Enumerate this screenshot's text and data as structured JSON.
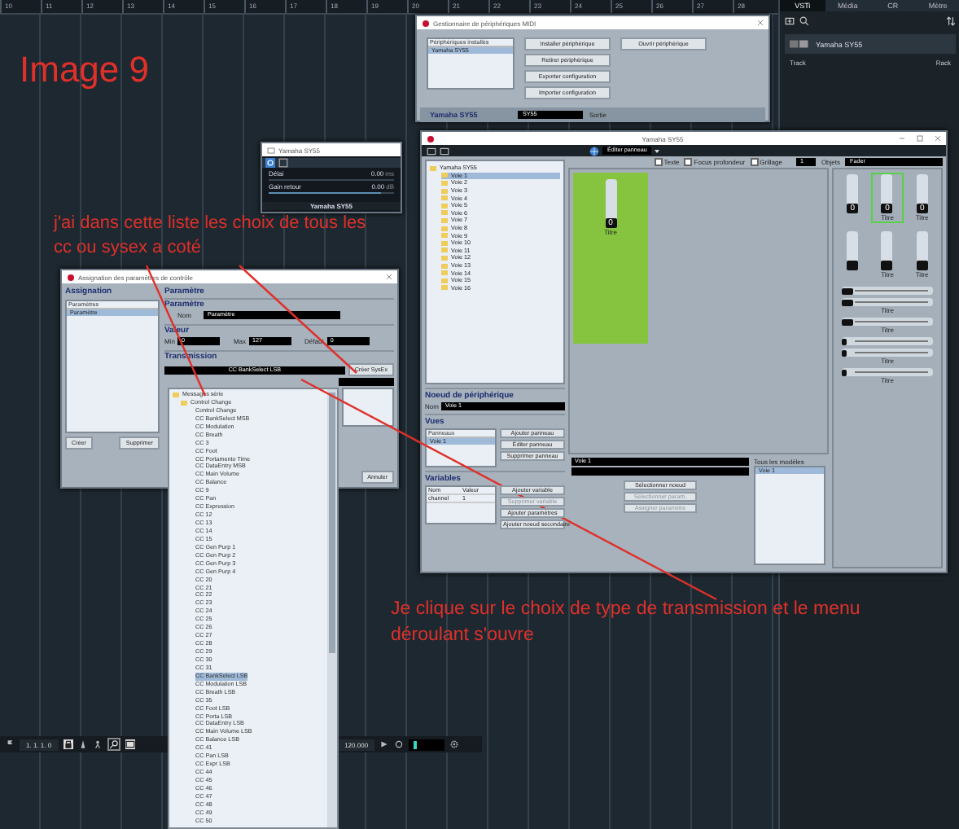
{
  "ruler": [
    "10",
    "11",
    "12",
    "13",
    "14",
    "15",
    "16",
    "17",
    "18",
    "19",
    "20",
    "21",
    "22",
    "23",
    "24",
    "25",
    "26",
    "27",
    "28"
  ],
  "title_note": "Image 9",
  "notes": [
    "j'ai dans cette liste les choix de tous les cc ou sysex a coté",
    "Je clique sur le choix de type de transmission et le menu déroulant s'ouvre"
  ],
  "right_panel": {
    "tabs": [
      {
        "label": "VSTi",
        "selected": true
      },
      {
        "label": "Média",
        "selected": false
      },
      {
        "label": "CR",
        "selected": false
      },
      {
        "label": "Mètre",
        "selected": false
      }
    ],
    "track": "Yamaha SY55",
    "track_button": "Track",
    "rack_button": "Rack"
  },
  "midi_manager": {
    "title": "Gestionnaire de périphériques MIDI",
    "list_header": "Périphériques installés",
    "devices": [
      {
        "name": "Yamaha SY55",
        "selected": true
      }
    ],
    "buttons": [
      "Installer périphérique",
      "Retirer périphérique",
      "Exporter configuration",
      "Importer configuration"
    ],
    "open_button": "Ouvrir périphérique",
    "device": "Yamaha SY55",
    "output": "SY55",
    "output_label": "Sortie"
  },
  "small_window": {
    "title": "Yamaha SY55",
    "rows": [
      {
        "label": "Délai",
        "value": "0.00",
        "unit": "ms"
      },
      {
        "label": "Gain retour",
        "value": "0.00",
        "unit": "dB",
        "level": 0.9
      }
    ],
    "footer": "Yamaha SY55"
  },
  "assign": {
    "title": "Assignation des paramètres de contrôle",
    "left_heading": "Assignation",
    "list_header": "Paramètres",
    "params": [
      {
        "name": "Paramètre",
        "selected": true
      }
    ],
    "create": "Créer",
    "delete": "Supprimer",
    "right_heading": "Paramètre",
    "param_heading": "Paramètre",
    "name_label": "Nom",
    "name": "Paramètre",
    "value_heading": "Valeur",
    "values": [
      {
        "label": "Min",
        "value": "0"
      },
      {
        "label": "Max",
        "value": "127"
      },
      {
        "label": "Défaut",
        "value": "0"
      }
    ],
    "transmission_heading": "Transmission",
    "transmission": "CC BankSelect LSB",
    "sysex_button": "Créer SysEx",
    "cancel": "Annuler"
  },
  "dropdown": {
    "root": "Messages série",
    "folder": "Control Change",
    "items": [
      {
        "label": "Control Change",
        "selected": false
      },
      {
        "label": "CC BankSelect MSB",
        "selected": false
      },
      {
        "label": "CC Modulation",
        "selected": false
      },
      {
        "label": "CC Breath",
        "selected": false
      },
      {
        "label": "CC 3",
        "selected": false
      },
      {
        "label": "CC Foot",
        "selected": false
      },
      {
        "label": "CC Portamento Time",
        "selected": false
      },
      {
        "label": "CC DataEntry MSB",
        "selected": false
      },
      {
        "label": "CC Main Volume",
        "selected": false
      },
      {
        "label": "CC Balance",
        "selected": false
      },
      {
        "label": "CC 9",
        "selected": false
      },
      {
        "label": "CC Pan",
        "selected": false
      },
      {
        "label": "CC Expression",
        "selected": false
      },
      {
        "label": "CC 12",
        "selected": false
      },
      {
        "label": "CC 13",
        "selected": false
      },
      {
        "label": "CC 14",
        "selected": false
      },
      {
        "label": "CC 15",
        "selected": false
      },
      {
        "label": "CC Gen Purp 1",
        "selected": false
      },
      {
        "label": "CC Gen Purp 2",
        "selected": false
      },
      {
        "label": "CC Gen Purp 3",
        "selected": false
      },
      {
        "label": "CC Gen Purp 4",
        "selected": false
      },
      {
        "label": "CC 20",
        "selected": false
      },
      {
        "label": "CC 21",
        "selected": false
      },
      {
        "label": "CC 22",
        "selected": false
      },
      {
        "label": "CC 23",
        "selected": false
      },
      {
        "label": "CC 24",
        "selected": false
      },
      {
        "label": "CC 25",
        "selected": false
      },
      {
        "label": "CC 26",
        "selected": false
      },
      {
        "label": "CC 27",
        "selected": false
      },
      {
        "label": "CC 28",
        "selected": false
      },
      {
        "label": "CC 29",
        "selected": false
      },
      {
        "label": "CC 30",
        "selected": false
      },
      {
        "label": "CC 31",
        "selected": false
      },
      {
        "label": "CC BankSelect LSB",
        "selected": true
      },
      {
        "label": "CC Modulation LSB",
        "selected": false
      },
      {
        "label": "CC Breath LSB",
        "selected": false
      },
      {
        "label": "CC 35",
        "selected": false
      },
      {
        "label": "CC Foot LSB",
        "selected": false
      },
      {
        "label": "CC Porta LSB",
        "selected": false
      },
      {
        "label": "CC DataEntry LSB",
        "selected": false
      },
      {
        "label": "CC Main Volume LSB",
        "selected": false
      },
      {
        "label": "CC Balance LSB",
        "selected": false
      },
      {
        "label": "CC 41",
        "selected": false
      },
      {
        "label": "CC Pan LSB",
        "selected": false
      },
      {
        "label": "CC Expr LSB",
        "selected": false
      },
      {
        "label": "CC 44",
        "selected": false
      },
      {
        "label": "CC 45",
        "selected": false
      },
      {
        "label": "CC 46",
        "selected": false
      },
      {
        "label": "CC 47",
        "selected": false
      },
      {
        "label": "CC 48",
        "selected": false
      },
      {
        "label": "CC 49",
        "selected": false
      },
      {
        "label": "CC 50",
        "selected": false
      }
    ]
  },
  "device_window": {
    "title": "Yamaha SY55",
    "mode": "Éditer panneau",
    "options": [
      {
        "label": "Texte",
        "checked": false
      },
      {
        "label": "Focus profondeur",
        "checked": false
      },
      {
        "label": "Grillage",
        "checked": false
      }
    ],
    "grid_size": "1",
    "objects_label": "Objets",
    "objects": "Fader",
    "tree": {
      "label": "Yamaha SY55",
      "children": [
        {
          "label": "Voie 1",
          "selected": true
        },
        {
          "label": "Voie 2",
          "selected": false
        },
        {
          "label": "Voie 3",
          "selected": false
        },
        {
          "label": "Voie 4",
          "selected": false
        },
        {
          "label": "Voie 5",
          "selected": false
        },
        {
          "label": "Voie 6",
          "selected": false
        },
        {
          "label": "Voie 7",
          "selected": false
        },
        {
          "label": "Voie 8",
          "selected": false
        },
        {
          "label": "Voie 9",
          "selected": false
        },
        {
          "label": "Voie 10",
          "selected": false
        },
        {
          "label": "Voie 11",
          "selected": false
        },
        {
          "label": "Voie 12",
          "selected": false
        },
        {
          "label": "Voie 13",
          "selected": false
        },
        {
          "label": "Voie 14",
          "selected": false
        },
        {
          "label": "Voie 15",
          "selected": false
        },
        {
          "label": "Voie 16",
          "selected": false
        }
      ]
    },
    "canvas_fader": {
      "value": "0",
      "title": "Titre"
    },
    "node_heading": "Noeud de périphérique",
    "node_name_label": "Nom",
    "node_name": "Voie 1",
    "views_heading": "Vues",
    "panels_header": "Panneaux",
    "panels": [
      {
        "label": "Voie 1",
        "selected": true
      }
    ],
    "panel_buttons": [
      {
        "label": "Ajouter panneau",
        "disabled": false
      },
      {
        "label": "Éditer panneau",
        "disabled": false
      },
      {
        "label": "Supprimer panneau",
        "disabled": false
      }
    ],
    "variables_heading": "Variables",
    "var_columns": [
      "Nom",
      "Valeur"
    ],
    "variables": [
      {
        "name": "channel",
        "value": "1"
      }
    ],
    "var_buttons": [
      {
        "label": "Ajouter variable",
        "disabled": false
      },
      {
        "label": "Supprimer variable",
        "disabled": true
      },
      {
        "label": "Ajouter paramètres",
        "disabled": false
      },
      {
        "label": "Ajouter noeud secondaire",
        "disabled": false
      }
    ],
    "node_field": "Voie 1",
    "select_buttons": [
      {
        "label": "Sélectionner noeud",
        "disabled": false
      },
      {
        "label": "Sélectionner param.",
        "disabled": true
      },
      {
        "label": "Assigner paramètre",
        "disabled": true
      }
    ],
    "models_label": "Tous les modèles",
    "models": [
      {
        "label": "Voie 1",
        "selected": true
      }
    ],
    "palette": {
      "vertical": [
        {
          "value": "0",
          "selected": false
        },
        {
          "value": "0",
          "title": "Titre",
          "selected": true
        },
        {
          "value": "0",
          "title": "Titre",
          "selected": false
        },
        {
          "selected": false
        },
        {
          "title": "Titre",
          "selected": false
        },
        {
          "title": "Titre",
          "selected": false
        }
      ],
      "horizontal": [
        {
          "kind": "knob"
        },
        {
          "kind": "knob",
          "title": "Titre"
        },
        {
          "kind": "knob",
          "title": "Titre"
        },
        {
          "kind": "thin"
        },
        {
          "kind": "thin",
          "title": "Titre"
        },
        {
          "kind": "thin",
          "title": "Titre"
        }
      ]
    }
  },
  "transport": {
    "position": "1. 1. 1. 0",
    "tempo": "120.000"
  }
}
